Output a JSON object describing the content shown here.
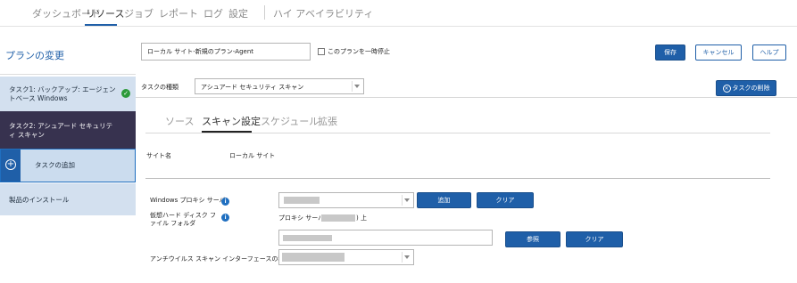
{
  "topnav": {
    "items": [
      "ダッシュボード",
      "リソース",
      "ジョブ",
      "レポート",
      "ログ",
      "設定",
      "ハイ アベイラビリティ"
    ],
    "active_index": 1
  },
  "sidebar": {
    "plan_title": "プランの変更",
    "items": [
      {
        "label": "タスク1: バックアップ: エージェントベース Windows",
        "status_icon": "check-icon"
      },
      {
        "label": "タスク2: アシュアード セキュリティ スキャン"
      },
      {
        "label": "タスクの追加",
        "icon": "plus-icon"
      },
      {
        "label": "製品のインストール"
      }
    ]
  },
  "plan": {
    "name_value": "ローカル サイト-新規のプラン-Agent",
    "pause_label": "このプランを一時停止",
    "save_label": "保存",
    "cancel_label": "キャンセル",
    "help_label": "ヘルプ"
  },
  "task": {
    "type_label": "タスクの種類",
    "type_value": "アシュアード セキュリティ スキャン",
    "delete_label": "タスクの削除"
  },
  "tabs": [
    "ソース",
    "スキャン設定",
    "スケジュール",
    "拡張"
  ],
  "active_tab": 1,
  "form": {
    "site_label": "サイト名",
    "site_value": "ローカル サイト",
    "proxy_label": "Windows プロキシ サーバ",
    "add_label": "追加",
    "clear_label": "クリア",
    "vhd_label": "仮想ハード ディスク ファイル フォルダ",
    "vhd_info_prefix": "プロキシ サーバ (",
    "vhd_info_suffix": ") 上",
    "browse_label": "参照",
    "clear2_label": "クリア",
    "av_label": "アンチウイルス スキャン インターフェースの種類"
  },
  "colors": {
    "accent": "#1f5fa8",
    "selected_task": "#37324f",
    "sidebar_bg": "#d3e0ef",
    "success": "#2c9a3a"
  }
}
